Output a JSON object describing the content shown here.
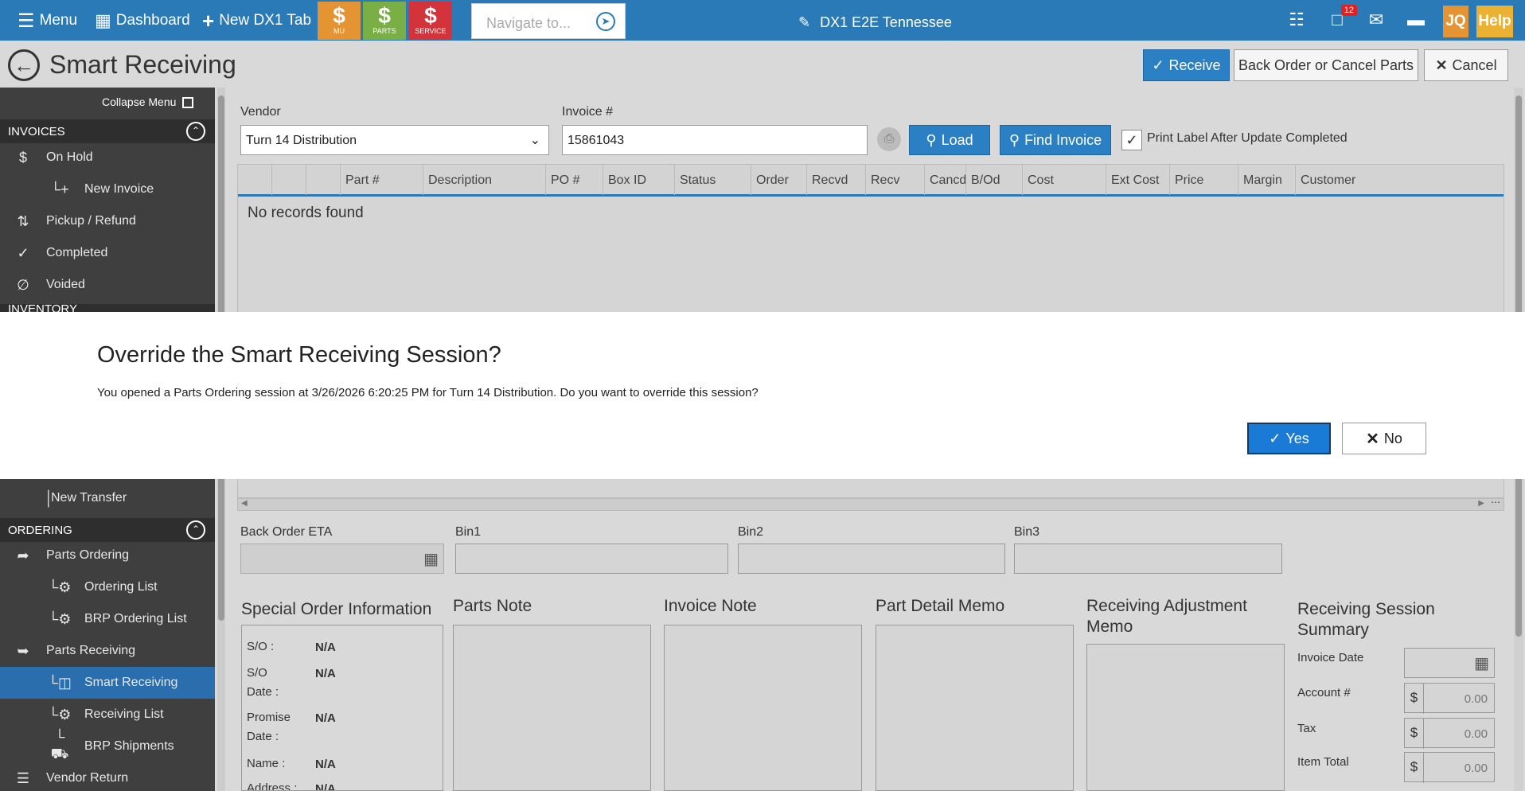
{
  "topbar": {
    "menu_label": "Menu",
    "dashboard_label": "Dashboard",
    "new_tab_label": "New DX1 Tab",
    "launchers": [
      {
        "label": "MU",
        "color": "#e59434"
      },
      {
        "label": "PARTS",
        "color": "#7aaf45"
      },
      {
        "label": "SERVICE",
        "color": "#d3333a"
      }
    ],
    "navigate_placeholder": "Navigate to...",
    "store_name": "DX1 E2E Tennessee",
    "notification_count": "12",
    "user_initials": "JQ",
    "help_label": "Help"
  },
  "header": {
    "title": "Smart Receiving",
    "receive_label": "Receive",
    "backorder_label": "Back Order or Cancel Parts",
    "cancel_label": "Cancel"
  },
  "sidebar": {
    "collapse_label": "Collapse Menu",
    "sections": {
      "invoices": "INVOICES",
      "inventory": "INVENTORY",
      "ordering": "ORDERING"
    },
    "items": {
      "on_hold": "On Hold",
      "new_invoice": "New Invoice",
      "pickup_refund": "Pickup / Refund",
      "completed": "Completed",
      "voided": "Voided",
      "new_transfer": "New Transfer",
      "parts_ordering": "Parts Ordering",
      "ordering_list": "Ordering List",
      "brp_ordering_list": "BRP Ordering List",
      "parts_receiving": "Parts Receiving",
      "smart_receiving": "Smart Receiving",
      "receiving_list": "Receiving List",
      "brp_shipments": "BRP Shipments",
      "vendor_return": "Vendor Return"
    }
  },
  "form": {
    "vendor_label": "Vendor",
    "vendor_value": "Turn 14 Distribution",
    "invoice_label": "Invoice #",
    "invoice_value": "15861043",
    "load_label": "Load",
    "find_invoice_label": "Find Invoice",
    "print_label": "Print Label After Update Completed"
  },
  "grid": {
    "columns": [
      "Part #",
      "Description",
      "PO #",
      "Box ID",
      "Status",
      "Order",
      "Recvd",
      "Recv",
      "Cancd",
      "B/Od",
      "Cost",
      "Ext Cost",
      "Price",
      "Margin",
      "Customer"
    ],
    "empty_text": "No records found"
  },
  "bins": {
    "back_order_eta_label": "Back Order ETA",
    "bin1_label": "Bin1",
    "bin2_label": "Bin2",
    "bin3_label": "Bin3"
  },
  "special_order": {
    "title": "Special Order Information",
    "so_label": "S/O :",
    "so_value": "N/A",
    "so_date_label": "S/O Date :",
    "so_date_value": "N/A",
    "promise_label": "Promise Date :",
    "promise_value": "N/A",
    "name_label": "Name :",
    "name_value": "N/A",
    "address_label": "Address :",
    "address_value": "N/A"
  },
  "memos": {
    "parts_note": "Parts Note",
    "invoice_note": "Invoice Note",
    "part_detail_memo": "Part Detail Memo",
    "receiving_adjustment_memo": "Receiving Adjustment Memo"
  },
  "summary": {
    "title": "Receiving Session Summary",
    "invoice_date_label": "Invoice Date",
    "account_label": "Account #",
    "account_value": "0.00",
    "tax_label": "Tax",
    "tax_value": "0.00",
    "item_total_label": "Item Total",
    "item_total_value": "0.00",
    "currency": "$"
  },
  "modal": {
    "title": "Override the Smart Receiving Session?",
    "message": "You opened a Parts Ordering session at 3/26/2026 6:20:25 PM for Turn 14 Distribution. Do you want to override this session?",
    "yes_label": "Yes",
    "no_label": "No"
  }
}
